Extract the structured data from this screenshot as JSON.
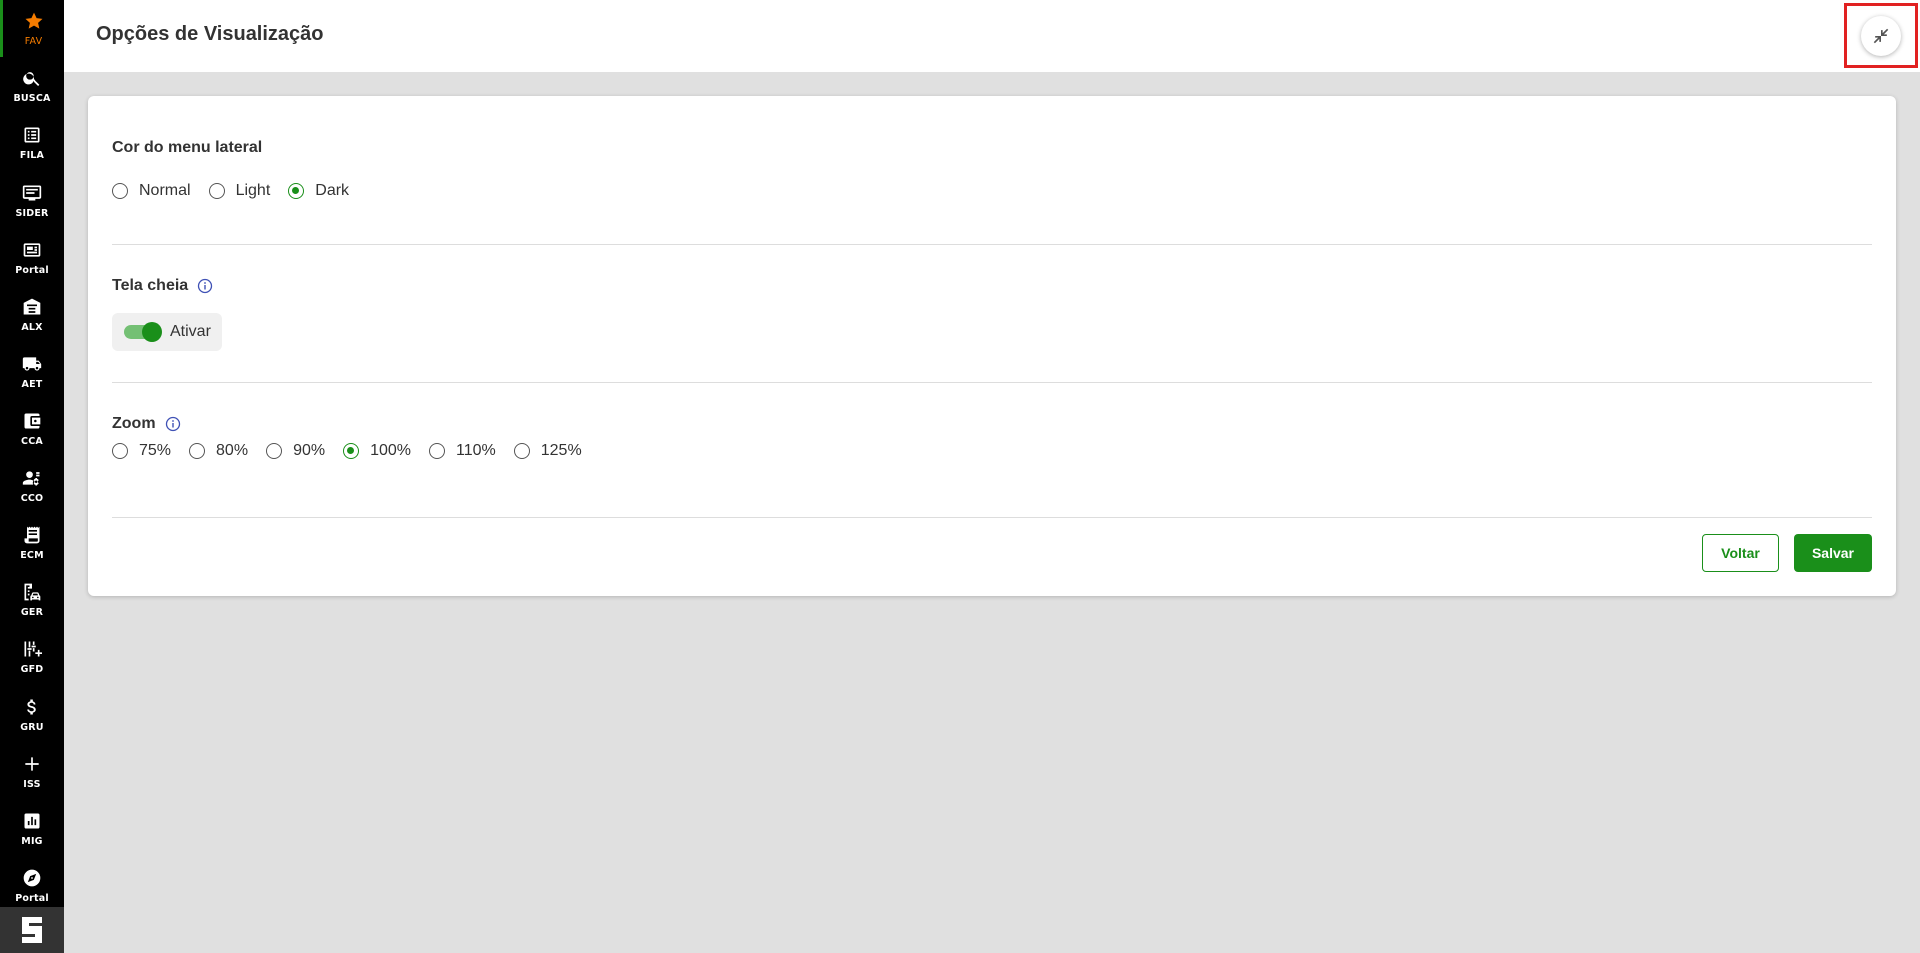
{
  "sidebar": {
    "items": [
      {
        "label": "FAV",
        "icon": "star-icon",
        "active": true
      },
      {
        "label": "BUSCA",
        "icon": "search-icon"
      },
      {
        "label": "FILA",
        "icon": "list-icon"
      },
      {
        "label": "SIDER",
        "icon": "monitor-icon"
      },
      {
        "label": "Portal",
        "icon": "news-icon"
      },
      {
        "label": "ALX",
        "icon": "warehouse-icon"
      },
      {
        "label": "AET",
        "icon": "truck-icon"
      },
      {
        "label": "CCA",
        "icon": "wallet-icon"
      },
      {
        "label": "CCO",
        "icon": "users-gear-icon"
      },
      {
        "label": "ECM",
        "icon": "receipt-icon"
      },
      {
        "label": "GER",
        "icon": "building-car-icon"
      },
      {
        "label": "GFD",
        "icon": "sliders-plus-icon"
      },
      {
        "label": "GRU",
        "icon": "dollar-icon"
      },
      {
        "label": "ISS",
        "icon": "plus-icon"
      },
      {
        "label": "MIG",
        "icon": "chart-icon"
      },
      {
        "label": "Portal",
        "icon": "compass-icon"
      }
    ],
    "brand_icon": "brand-logo-icon"
  },
  "header": {
    "title": "Opções de Visualização",
    "exit_fullscreen_icon": "exit-fullscreen-icon"
  },
  "menu_color": {
    "title": "Cor do menu lateral",
    "options": [
      "Normal",
      "Light",
      "Dark"
    ],
    "selected": "Dark"
  },
  "fullscreen": {
    "title": "Tela cheia",
    "toggle_label": "Ativar",
    "enabled": true
  },
  "zoom": {
    "title": "Zoom",
    "options": [
      "75%",
      "80%",
      "90%",
      "100%",
      "110%",
      "125%"
    ],
    "selected": "100%"
  },
  "actions": {
    "back_label": "Voltar",
    "save_label": "Salvar"
  },
  "colors": {
    "accent": "#1a8f1a",
    "sidebar_bg": "#000000",
    "active_icon": "#f57c00",
    "highlight": "#e12121",
    "info": "#3f51b5"
  }
}
